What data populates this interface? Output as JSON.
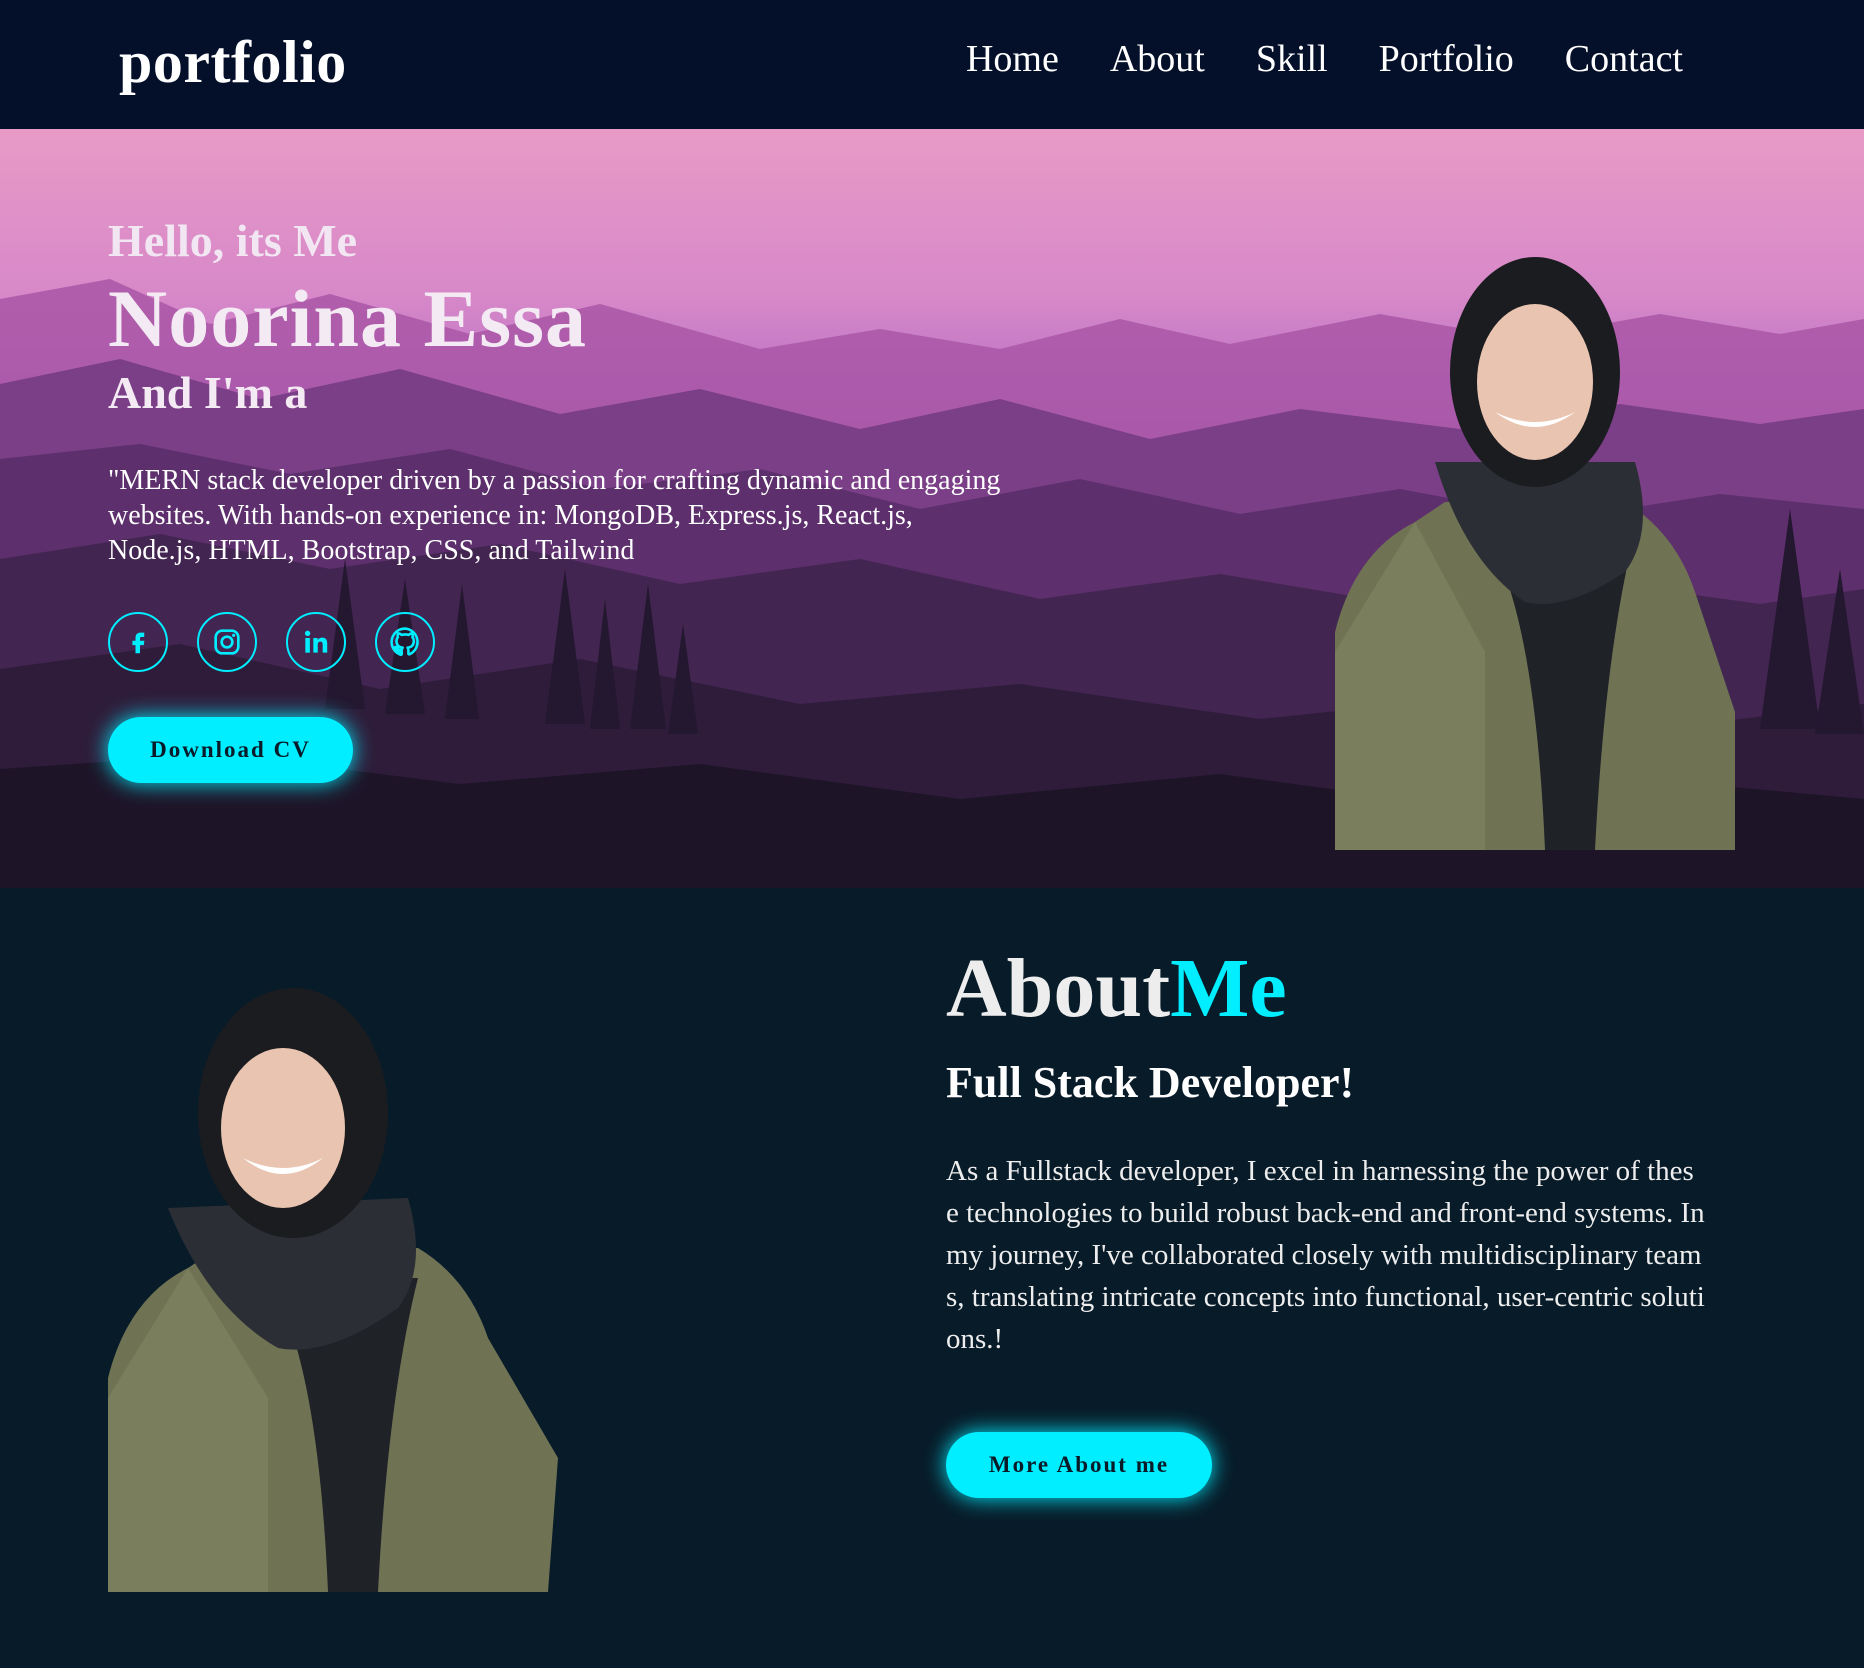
{
  "header": {
    "logo": "portfolio",
    "nav": [
      "Home",
      "About",
      "Skill",
      "Portfolio",
      "Contact"
    ]
  },
  "hero": {
    "greeting": "Hello, its Me",
    "name": "Noorina Essa",
    "role_prefix": "And I'm a",
    "bio": "\"MERN stack developer driven by a passion for crafting dynamic and engaging websites. With hands-on experience in: MongoDB, Express.js, React.js, Node.js, HTML, Bootstrap, CSS, and Tailwind",
    "socials": [
      "facebook-icon",
      "instagram-icon",
      "linkedin-icon",
      "github-icon"
    ],
    "download_label": "Download CV"
  },
  "about": {
    "title_main": "About",
    "title_accent": "Me",
    "subtitle": "Full Stack Developer!",
    "text": "As a Fullstack developer, I excel in harnessing the power of these technologies to build robust back-end and front-end systems. In my journey, I've collaborated closely with multidisciplinary teams, translating intricate concepts into functional, user-centric solutions.!",
    "more_label": "More About me"
  },
  "colors": {
    "accent": "#00eeff",
    "background": "#081b29",
    "header": "#040f2a"
  }
}
